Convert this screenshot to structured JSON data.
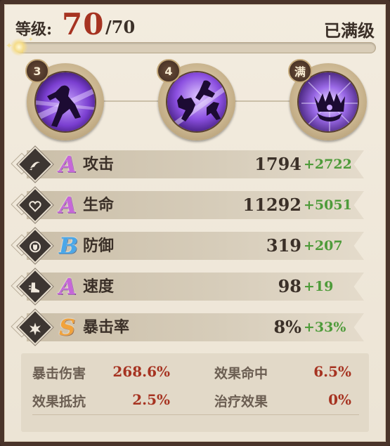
{
  "header": {
    "level_label": "等级:",
    "level_current": "70",
    "level_max": "/70",
    "status": "已满级",
    "xp_fill_fraction": 0.02
  },
  "skills": [
    {
      "badge": "3",
      "icon": "dash-strike-skill-icon"
    },
    {
      "badge": "4",
      "icon": "beast-pack-skill-icon"
    },
    {
      "badge": "满",
      "icon": "dark-crown-skill-icon"
    }
  ],
  "stats": [
    {
      "icon": "attack-icon",
      "grade": "A",
      "name": "攻击",
      "value": "1794",
      "bonus": "+2722"
    },
    {
      "icon": "health-icon",
      "grade": "A",
      "name": "生命",
      "value": "11292",
      "bonus": "+5051"
    },
    {
      "icon": "defense-icon",
      "grade": "B",
      "name": "防御",
      "value": "319",
      "bonus": "+207"
    },
    {
      "icon": "speed-icon",
      "grade": "A",
      "name": "速度",
      "value": "98",
      "bonus": "+19"
    },
    {
      "icon": "crit-rate-icon",
      "grade": "S",
      "name": "暴击率",
      "value": "8%",
      "bonus": "+33%"
    }
  ],
  "extra_stats": [
    {
      "label": "暴击伤害",
      "value": "268.6%"
    },
    {
      "label": "效果命中",
      "value": "6.5%"
    },
    {
      "label": "效果抵抗",
      "value": "2.5%"
    },
    {
      "label": "治疗效果",
      "value": "0%"
    }
  ],
  "colors": {
    "level_number": "#a63321",
    "bonus_green": "#4e9b3a",
    "extra_value_red": "#a63321",
    "grade_A": "#c667d8",
    "grade_B": "#4aa7e8",
    "grade_S": "#f2a33b"
  }
}
